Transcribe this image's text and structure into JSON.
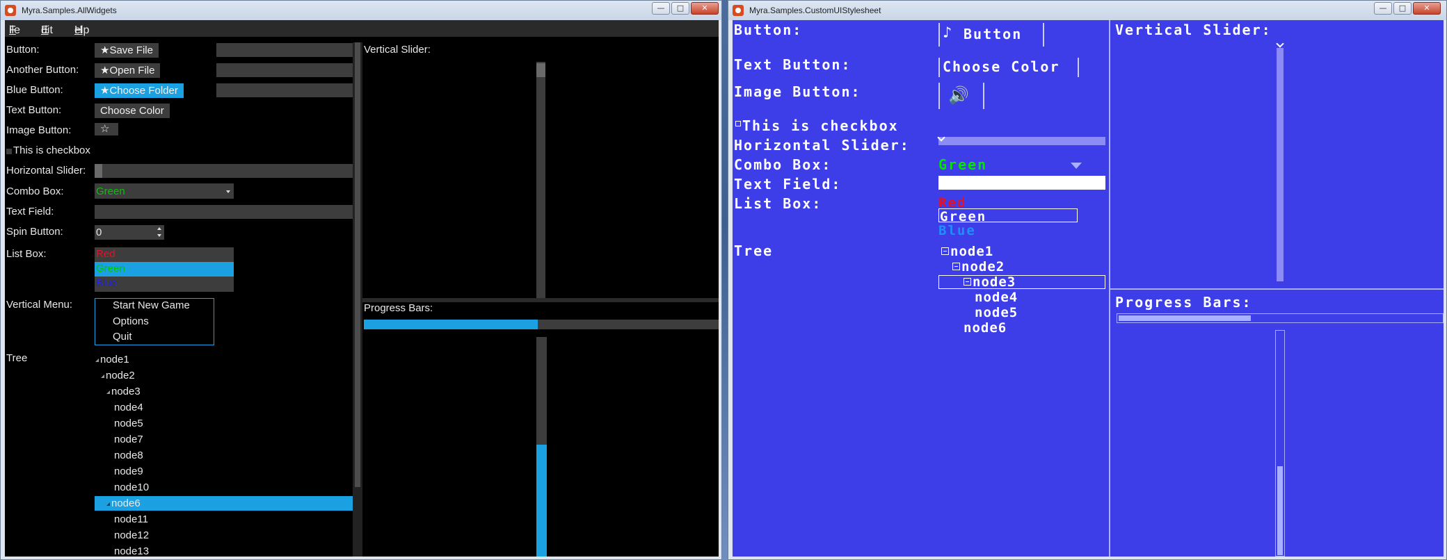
{
  "left_window": {
    "title": "Myra.Samples.AllWidgets",
    "controls": {
      "minimize": "—",
      "maximize": "□",
      "close": "✕"
    },
    "menu": [
      {
        "accel": "F",
        "rest": "ile"
      },
      {
        "accel": "E",
        "rest": "dit"
      },
      {
        "accel": "H",
        "rest": "elp"
      }
    ],
    "labels": {
      "button": "Button:",
      "another_button": "Another Button:",
      "blue_button": "Blue Button:",
      "text_button": "Text Button:",
      "image_button": "Image Button:",
      "checkbox": "This is checkbox",
      "horizontal_slider": "Horizontal Slider:",
      "combo_box": "Combo Box:",
      "text_field": "Text Field:",
      "spin_button": "Spin Button:",
      "list_box": "List Box:",
      "vertical_menu": "Vertical Menu:",
      "tree": "Tree",
      "vertical_slider": "Vertical Slider:",
      "progress_bars": "Progress Bars:"
    },
    "buttons": {
      "save_file": "★Save File",
      "open_file": "★Open File",
      "choose_folder": "★Choose Folder",
      "choose_color": "Choose Color",
      "image_star": "☆"
    },
    "combo_value": "Green",
    "spin_value": "0",
    "list_items": [
      {
        "label": "Red",
        "color": "#e81123"
      },
      {
        "label": "Green",
        "color": "#00c800"
      },
      {
        "label": "Blue",
        "color": "#2020e8"
      }
    ],
    "menu_items": [
      "Start New Game",
      "Options",
      "Quit"
    ],
    "tree_nodes": [
      "node1",
      "node2",
      "node3",
      "node4",
      "node5",
      "node7",
      "node8",
      "node9",
      "node10",
      "node6",
      "node11",
      "node12",
      "node13"
    ],
    "selected_node": "node6",
    "horizontal_progress": 0.49,
    "vertical_progress": 0.51,
    "accent_color": "#1ba1e2"
  },
  "right_window": {
    "title": "Myra.Samples.CustomUIStylesheet",
    "controls": {
      "minimize": "—",
      "maximize": "□",
      "close": "✕"
    },
    "labels": {
      "button": "Button:",
      "text_button": "Text Button:",
      "image_button": "Image Button:",
      "checkbox": "This is checkbox",
      "horizontal_slider": "Horizontal Slider:",
      "combo_box": "Combo Box:",
      "text_field": "Text Field:",
      "list_box": "List Box:",
      "tree": "Tree",
      "vertical_slider": "Vertical Slider:",
      "progress_bars": "Progress Bars:"
    },
    "buttons": {
      "button": "Button",
      "choose_color": "Choose Color"
    },
    "combo_value": "Green",
    "list_items": [
      {
        "label": "Red",
        "color": "#e81123"
      },
      {
        "label": "Green",
        "color": "#ffffff"
      },
      {
        "label": "Blue",
        "color": "#1e90ff"
      }
    ],
    "tree_nodes": [
      "node1",
      "node2",
      "node3",
      "node4",
      "node5",
      "node6"
    ],
    "horizontal_progress": 0.41,
    "vertical_progress": 0.4,
    "background_color": "#3e3ee8"
  }
}
